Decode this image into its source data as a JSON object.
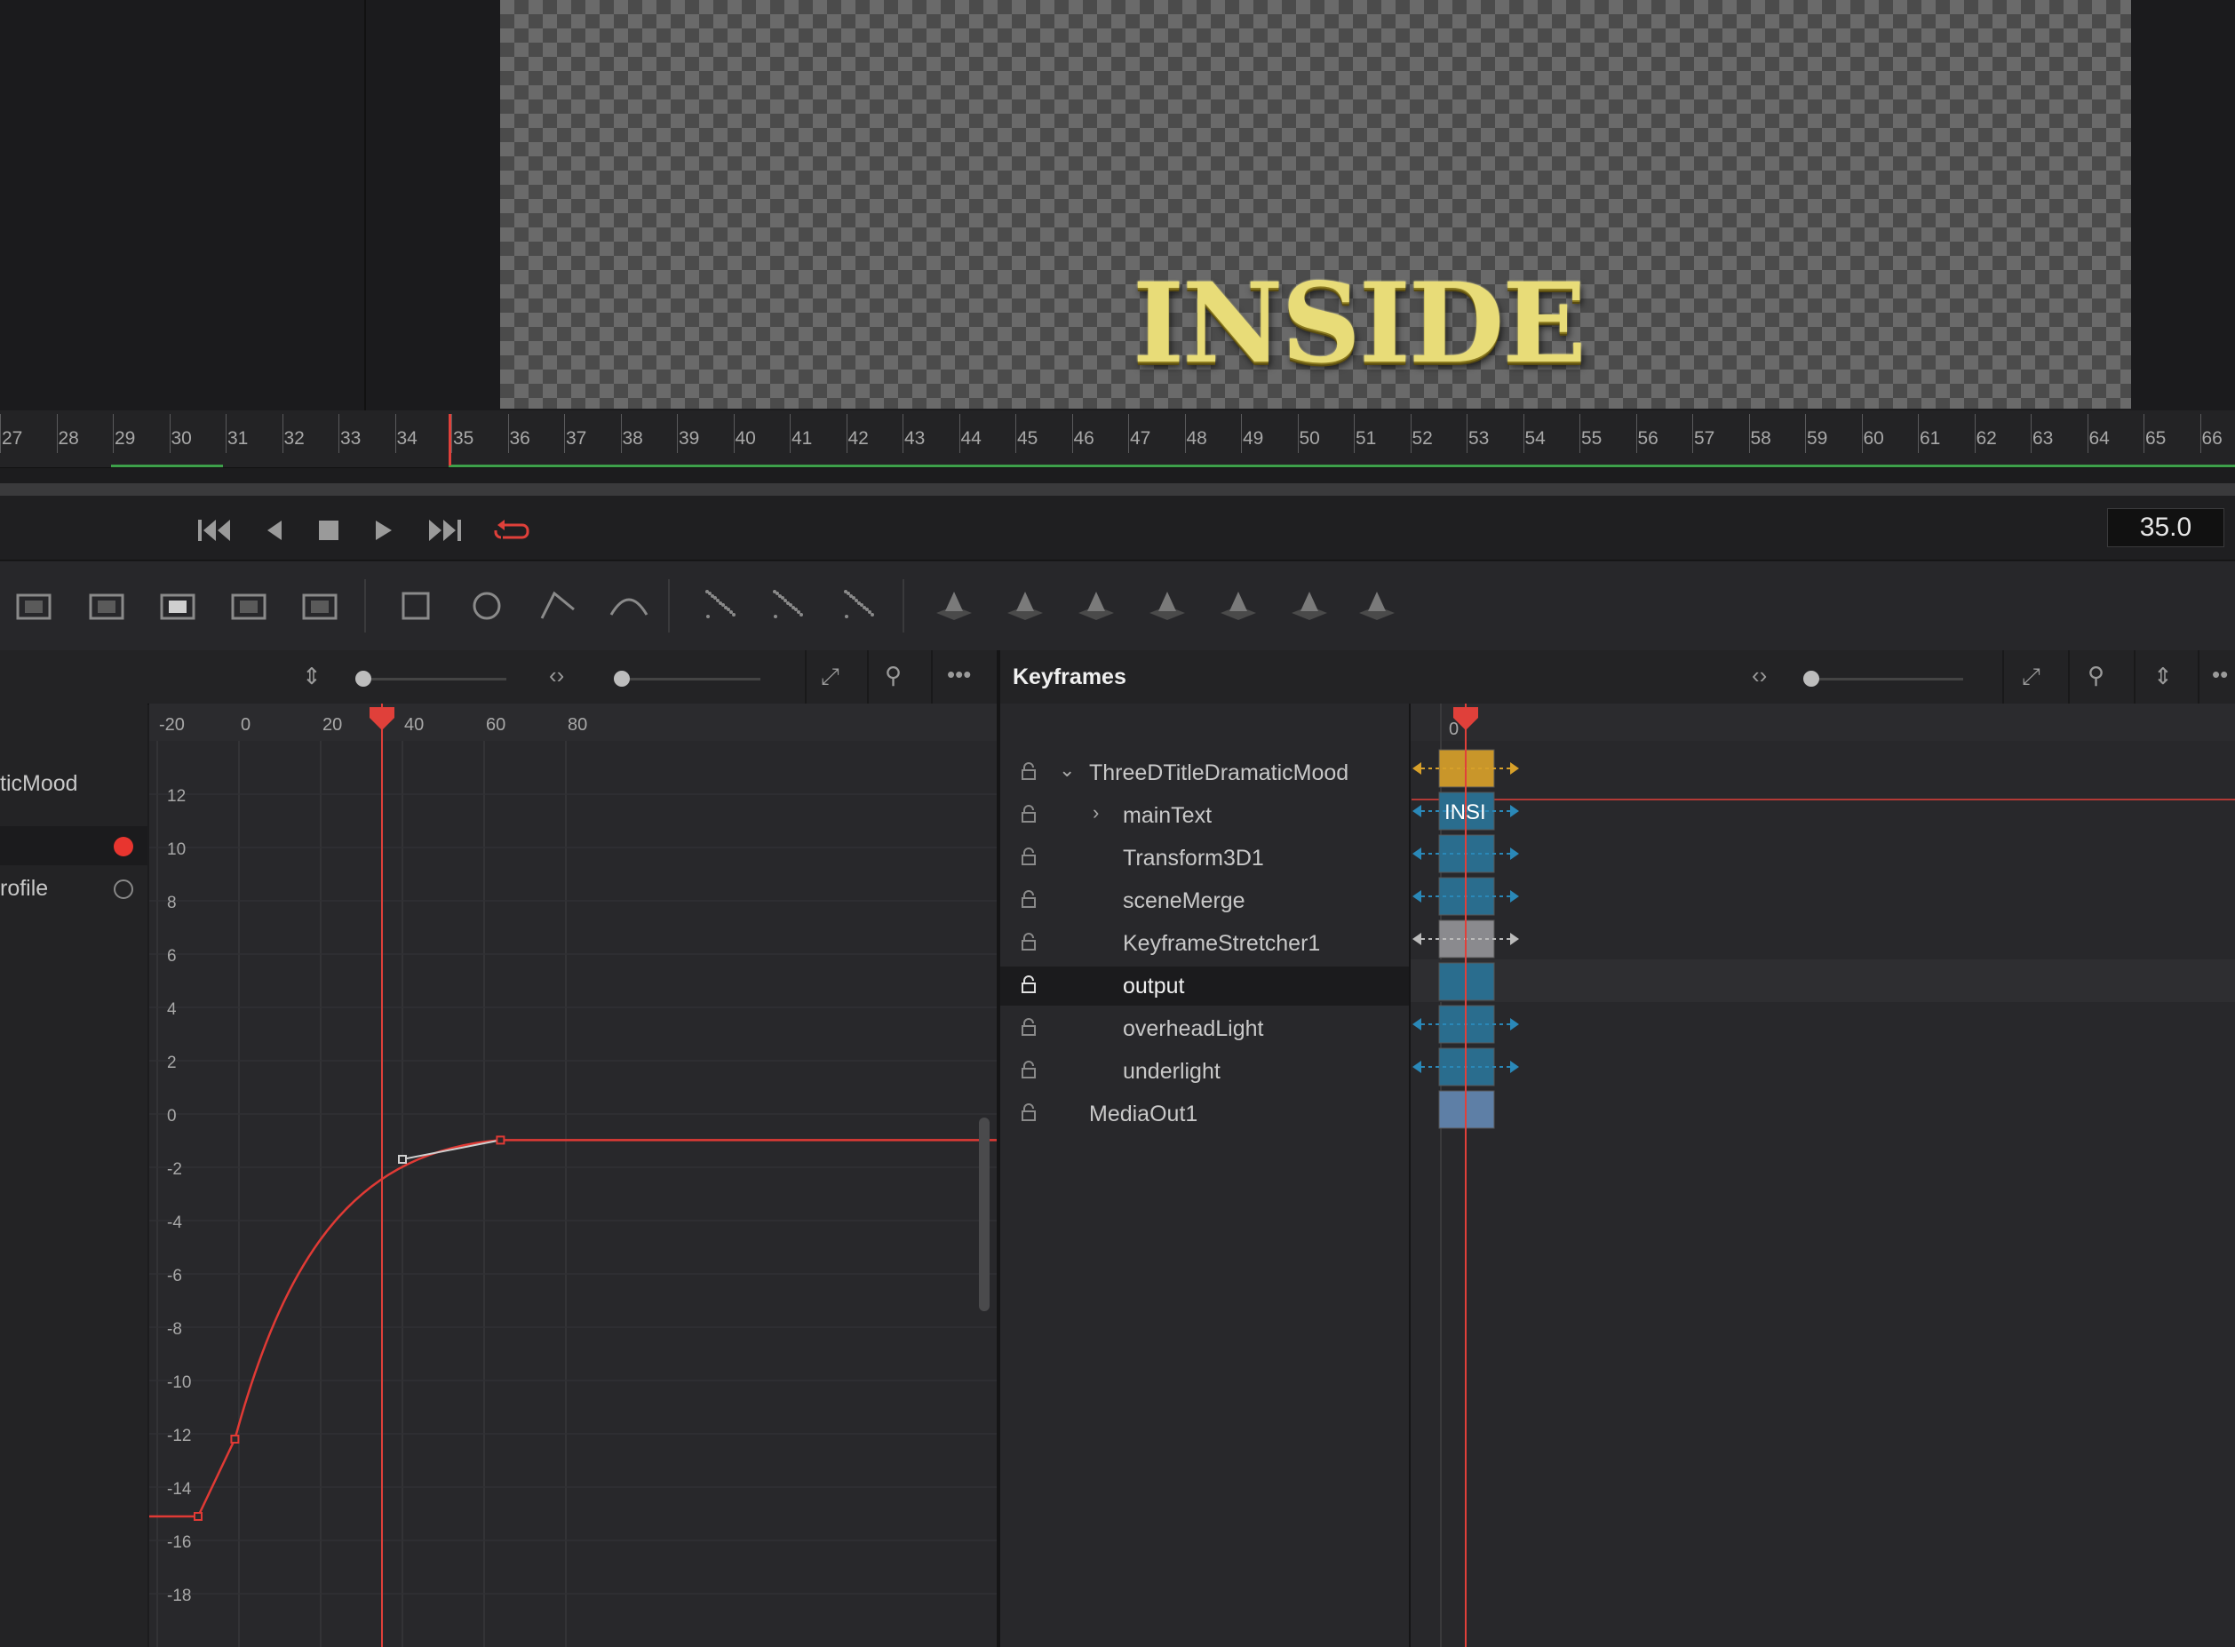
{
  "viewer": {
    "preview_text": "INSIDE"
  },
  "timeline_ruler": {
    "ticks": [
      "27",
      "28",
      "29",
      "30",
      "31",
      "32",
      "33",
      "34",
      "35",
      "36",
      "37",
      "38",
      "39",
      "40",
      "41",
      "42",
      "43",
      "44",
      "45",
      "46",
      "47",
      "48",
      "49",
      "50",
      "51",
      "52",
      "53",
      "54",
      "55",
      "56",
      "57",
      "58",
      "59",
      "60",
      "61",
      "62",
      "63",
      "64",
      "65",
      "66"
    ]
  },
  "transport": {
    "buttons": [
      "go-to-start",
      "step-back",
      "stop",
      "play",
      "go-to-end",
      "loop"
    ],
    "timecode": "35.0"
  },
  "toolbar": {
    "tools": [
      "background",
      "merge",
      "mask",
      "transform",
      "resize",
      "rectangle",
      "ellipse",
      "polygon",
      "bspline",
      "particle-emitter",
      "particle-render",
      "particle-style",
      "shape3d",
      "merge3d",
      "text3d",
      "renderer3d",
      "camera3d",
      "light3d",
      "image-plane3d"
    ]
  },
  "spline_editor": {
    "list_items": [
      {
        "label": "ticMood",
        "dot": "none"
      },
      {
        "label": "",
        "dot": "red"
      },
      {
        "label": "rofile",
        "dot": "outline"
      }
    ],
    "x_ticks": [
      "-20",
      "0",
      "20",
      "40",
      "60",
      "80"
    ],
    "y_ticks": [
      "12",
      "10",
      "8",
      "6",
      "4",
      "2",
      "0",
      "-2",
      "-4",
      "-6",
      "-8",
      "-10",
      "-12",
      "-14",
      "-16",
      "-18"
    ],
    "playhead_frame": 35,
    "curve_points": [
      [
        -28,
        -15.1
      ],
      [
        -10,
        -15.1
      ],
      [
        -1,
        -12.2
      ],
      [
        64,
        -0.98
      ]
    ],
    "handle_point": [
      40,
      -1.7
    ],
    "curve_color": "#e03a35"
  },
  "keyframes": {
    "title": "Keyframes",
    "ruler_label": "0",
    "tree": [
      {
        "label": "ThreeDTitleDramaticMood",
        "toggle": "⌄",
        "indent": 0,
        "color": "#c9962a",
        "selected": false
      },
      {
        "label": "mainText",
        "toggle": "›",
        "indent": 1,
        "color": "#2a6d8e",
        "selected": false,
        "bar_text": "INSI"
      },
      {
        "label": "Transform3D1",
        "toggle": "",
        "indent": 1,
        "color": "#2a6d8e",
        "selected": false
      },
      {
        "label": "sceneMerge",
        "toggle": "",
        "indent": 1,
        "color": "#2a6d8e",
        "selected": false
      },
      {
        "label": "KeyframeStretcher1",
        "toggle": "",
        "indent": 1,
        "color": "#8a8a8e",
        "selected": false
      },
      {
        "label": "output",
        "toggle": "",
        "indent": 1,
        "color": "#2a6d8e",
        "selected": true
      },
      {
        "label": "overheadLight",
        "toggle": "",
        "indent": 1,
        "color": "#2a6d8e",
        "selected": false
      },
      {
        "label": "underlight",
        "toggle": "",
        "indent": 1,
        "color": "#2a6d8e",
        "selected": false
      },
      {
        "label": "MediaOut1",
        "toggle": "",
        "indent": 0,
        "color": "#5e7fa6",
        "selected": false
      }
    ]
  }
}
